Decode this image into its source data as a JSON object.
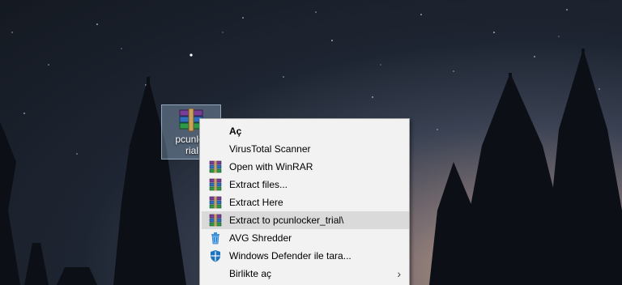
{
  "desktop": {
    "file_icon": {
      "label": "pcunlocker_trial",
      "label_display": "pcunloc\nrial"
    }
  },
  "context_menu": {
    "items": [
      {
        "label": "Aç",
        "bold": true,
        "icon": ""
      },
      {
        "label": "VirusTotal Scanner",
        "icon": ""
      },
      {
        "label": "Open with WinRAR",
        "icon": "winrar-icon"
      },
      {
        "label": "Extract files...",
        "icon": "winrar-icon"
      },
      {
        "label": "Extract Here",
        "icon": "winrar-icon"
      },
      {
        "label": "Extract to pcunlocker_trial\\",
        "icon": "winrar-icon",
        "highlighted": true
      },
      {
        "label": "AVG Shredder",
        "icon": "trash-icon"
      },
      {
        "label": "Windows Defender ile tara...",
        "icon": "defender-shield-icon"
      },
      {
        "label": "Birlikte aç",
        "icon": "",
        "submenu": true
      }
    ]
  },
  "colors": {
    "menu_bg": "#f2f2f2",
    "menu_hover": "#dadada",
    "selection": "#aac8e6"
  }
}
